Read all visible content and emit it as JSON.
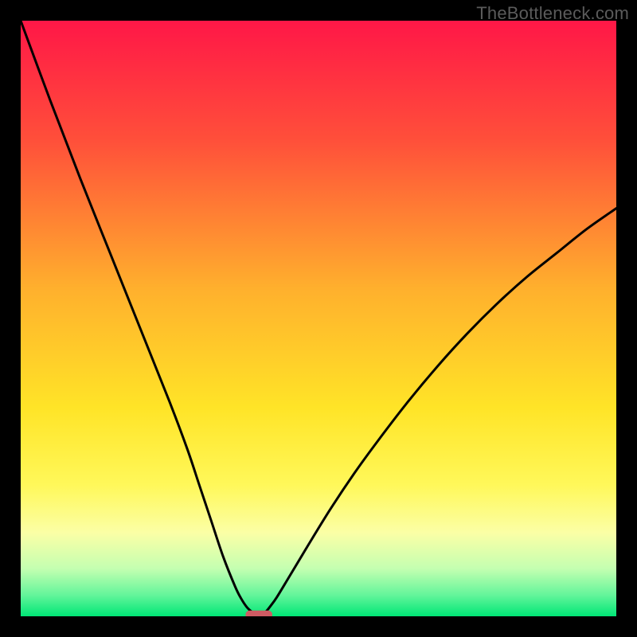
{
  "watermark": "TheBottleneck.com",
  "chart_data": {
    "type": "line",
    "title": "",
    "xlabel": "",
    "ylabel": "",
    "xlim": [
      0,
      100
    ],
    "ylim": [
      0,
      100
    ],
    "grid": false,
    "legend": false,
    "background_gradient": {
      "stops": [
        {
          "pos": 0.0,
          "color": "#ff1747"
        },
        {
          "pos": 0.2,
          "color": "#ff4f3a"
        },
        {
          "pos": 0.45,
          "color": "#ffb02d"
        },
        {
          "pos": 0.65,
          "color": "#ffe427"
        },
        {
          "pos": 0.78,
          "color": "#fff85a"
        },
        {
          "pos": 0.86,
          "color": "#fbffa6"
        },
        {
          "pos": 0.92,
          "color": "#c4ffb1"
        },
        {
          "pos": 0.965,
          "color": "#62f59a"
        },
        {
          "pos": 1.0,
          "color": "#00e676"
        }
      ]
    },
    "series": [
      {
        "name": "bottleneck-curve",
        "stroke": "#000000",
        "x": [
          0,
          5,
          10,
          15,
          20,
          25,
          28,
          30,
          32,
          34,
          36,
          37,
          38,
          39,
          40,
          41,
          42,
          43,
          45,
          48,
          52,
          56,
          60,
          65,
          70,
          75,
          80,
          85,
          90,
          95,
          100
        ],
        "values": [
          100,
          86.5,
          73.5,
          61.0,
          48.5,
          36.0,
          28.0,
          22.0,
          16.0,
          10.0,
          5.0,
          3.0,
          1.5,
          0.6,
          0.0,
          0.6,
          1.8,
          3.2,
          6.5,
          11.5,
          18.0,
          24.0,
          29.5,
          36.0,
          42.0,
          47.5,
          52.5,
          57.0,
          61.0,
          65.0,
          68.5
        ]
      }
    ],
    "marker": {
      "name": "optimal-marker",
      "x": 40,
      "y": 0,
      "width": 4.5,
      "height": 1.4,
      "color": "#cf5b63"
    }
  }
}
